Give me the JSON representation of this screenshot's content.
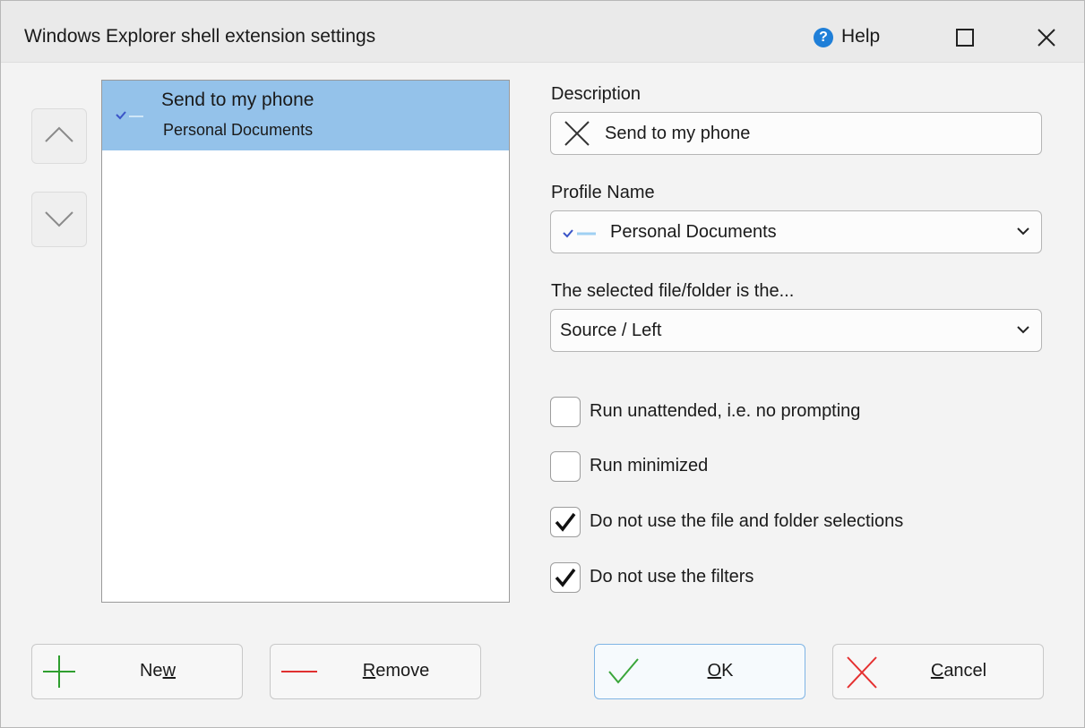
{
  "window": {
    "title": "Windows Explorer shell extension settings",
    "help_label": "Help"
  },
  "list": {
    "items": [
      {
        "title": "Send to my phone",
        "subtitle": "Personal Documents",
        "selected": true
      }
    ]
  },
  "form": {
    "description_label": "Description",
    "description_value": "Send to my phone",
    "profile_label": "Profile Name",
    "profile_value": "Personal Documents",
    "selection_label": "The selected file/folder is the...",
    "selection_value": "Source / Left",
    "checkboxes": [
      {
        "label": "Run unattended, i.e. no prompting",
        "checked": false
      },
      {
        "label": "Run minimized",
        "checked": false
      },
      {
        "label": "Do not use the file and folder selections",
        "checked": true
      },
      {
        "label": "Do not use the filters",
        "checked": true
      }
    ]
  },
  "buttons": {
    "new": {
      "pre": "Ne",
      "accel": "w",
      "post": ""
    },
    "remove": {
      "pre": "",
      "accel": "R",
      "post": "emove"
    },
    "ok": {
      "pre": "",
      "accel": "O",
      "post": "K"
    },
    "cancel": {
      "pre": "",
      "accel": "C",
      "post": "ancel"
    }
  },
  "colors": {
    "selection": "#94c2ea",
    "accent": "#1f7fd8",
    "add_green": "#2e9e2e",
    "remove_red": "#e03030",
    "cancel_red": "#e53030",
    "ok_green": "#3aa63a"
  },
  "icons": [
    "help-icon",
    "maximize-icon",
    "close-icon",
    "chevron-up-icon",
    "chevron-down-icon",
    "profile-check-icon",
    "clear-icon",
    "checkmark-icon",
    "plus-icon",
    "minus-icon",
    "ok-check-icon",
    "cancel-x-icon"
  ]
}
